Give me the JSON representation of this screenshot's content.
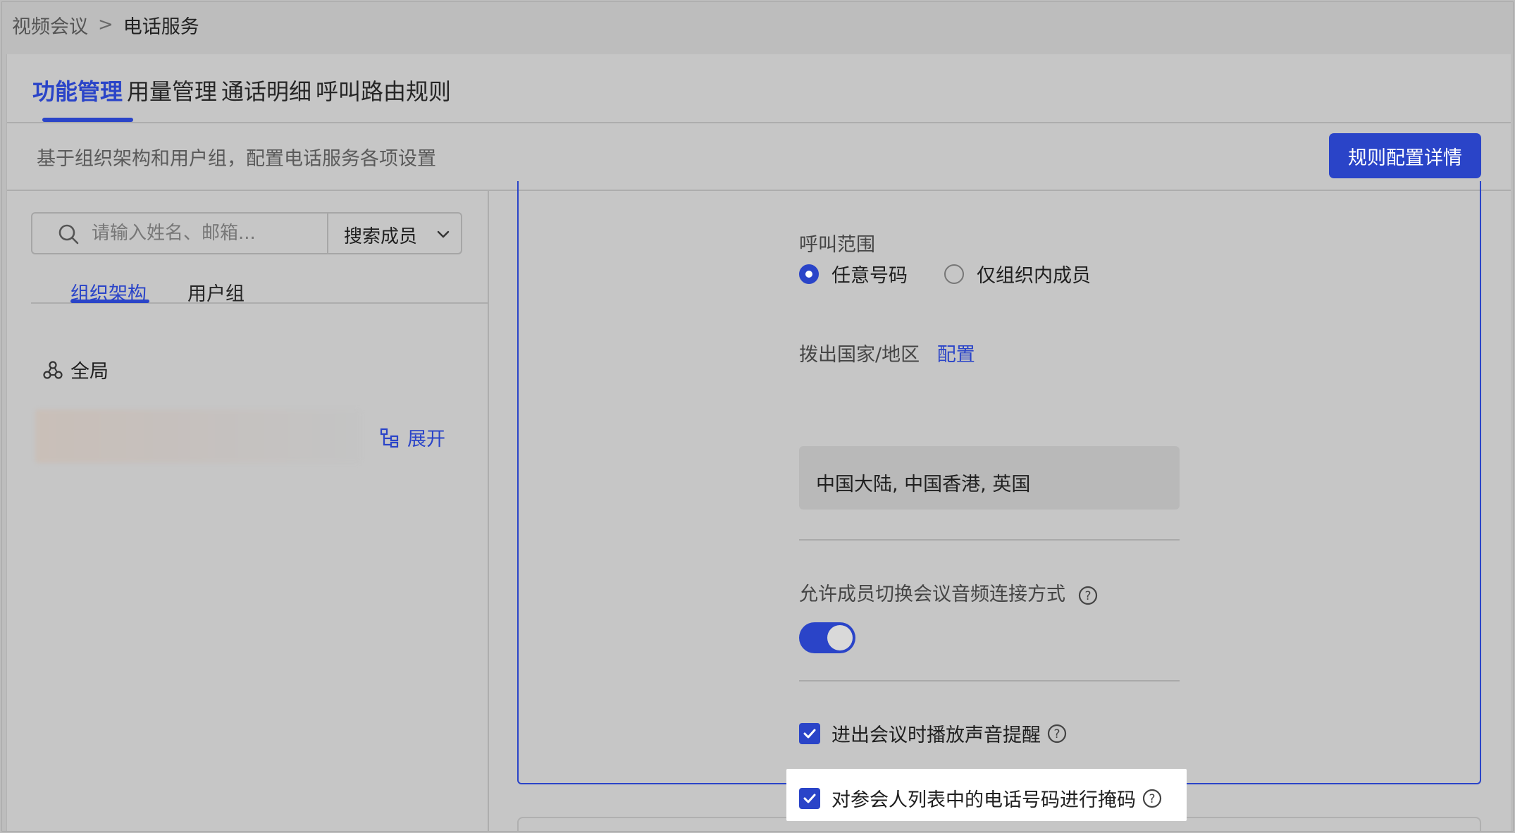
{
  "breadcrumb": {
    "root": "视频会议",
    "separator": ">",
    "current": "电话服务"
  },
  "tabs": [
    {
      "label": "功能管理",
      "active": true
    },
    {
      "label": "用量管理",
      "active": false
    },
    {
      "label": "通话明细",
      "active": false
    },
    {
      "label": "呼叫路由规则",
      "active": false
    }
  ],
  "description": "基于组织架构和用户组，配置电话服务各项设置",
  "rule_details_button": "规则配置详情",
  "sidebar": {
    "search": {
      "placeholder": "请输入姓名、邮箱...",
      "value": "",
      "scope_select": "搜索成员"
    },
    "subtabs": [
      {
        "label": "组织架构",
        "active": true
      },
      {
        "label": "用户组",
        "active": false
      }
    ],
    "tree_root": "全局",
    "expand_label": "展开"
  },
  "settings": {
    "call_scope": {
      "label": "呼叫范围",
      "options": [
        {
          "label": "任意号码",
          "selected": true
        },
        {
          "label": "仅组织内成员",
          "selected": false
        }
      ]
    },
    "dial_out_regions": {
      "label": "拨出国家/地区",
      "config_link": "配置",
      "value": "中国大陆, 中国香港, 英国"
    },
    "audio_switch": {
      "label": "允许成员切换会议音频连接方式",
      "enabled": true
    },
    "join_leave_sound": {
      "label": "进出会议时播放声音提醒",
      "checked": true
    },
    "mask_phone_numbers": {
      "label": "对参会人列表中的电话号码进行掩码",
      "checked": true
    }
  },
  "colors": {
    "accent": "#2a44c8",
    "background": "#c6c6c6",
    "highlight": "#ffffff"
  }
}
